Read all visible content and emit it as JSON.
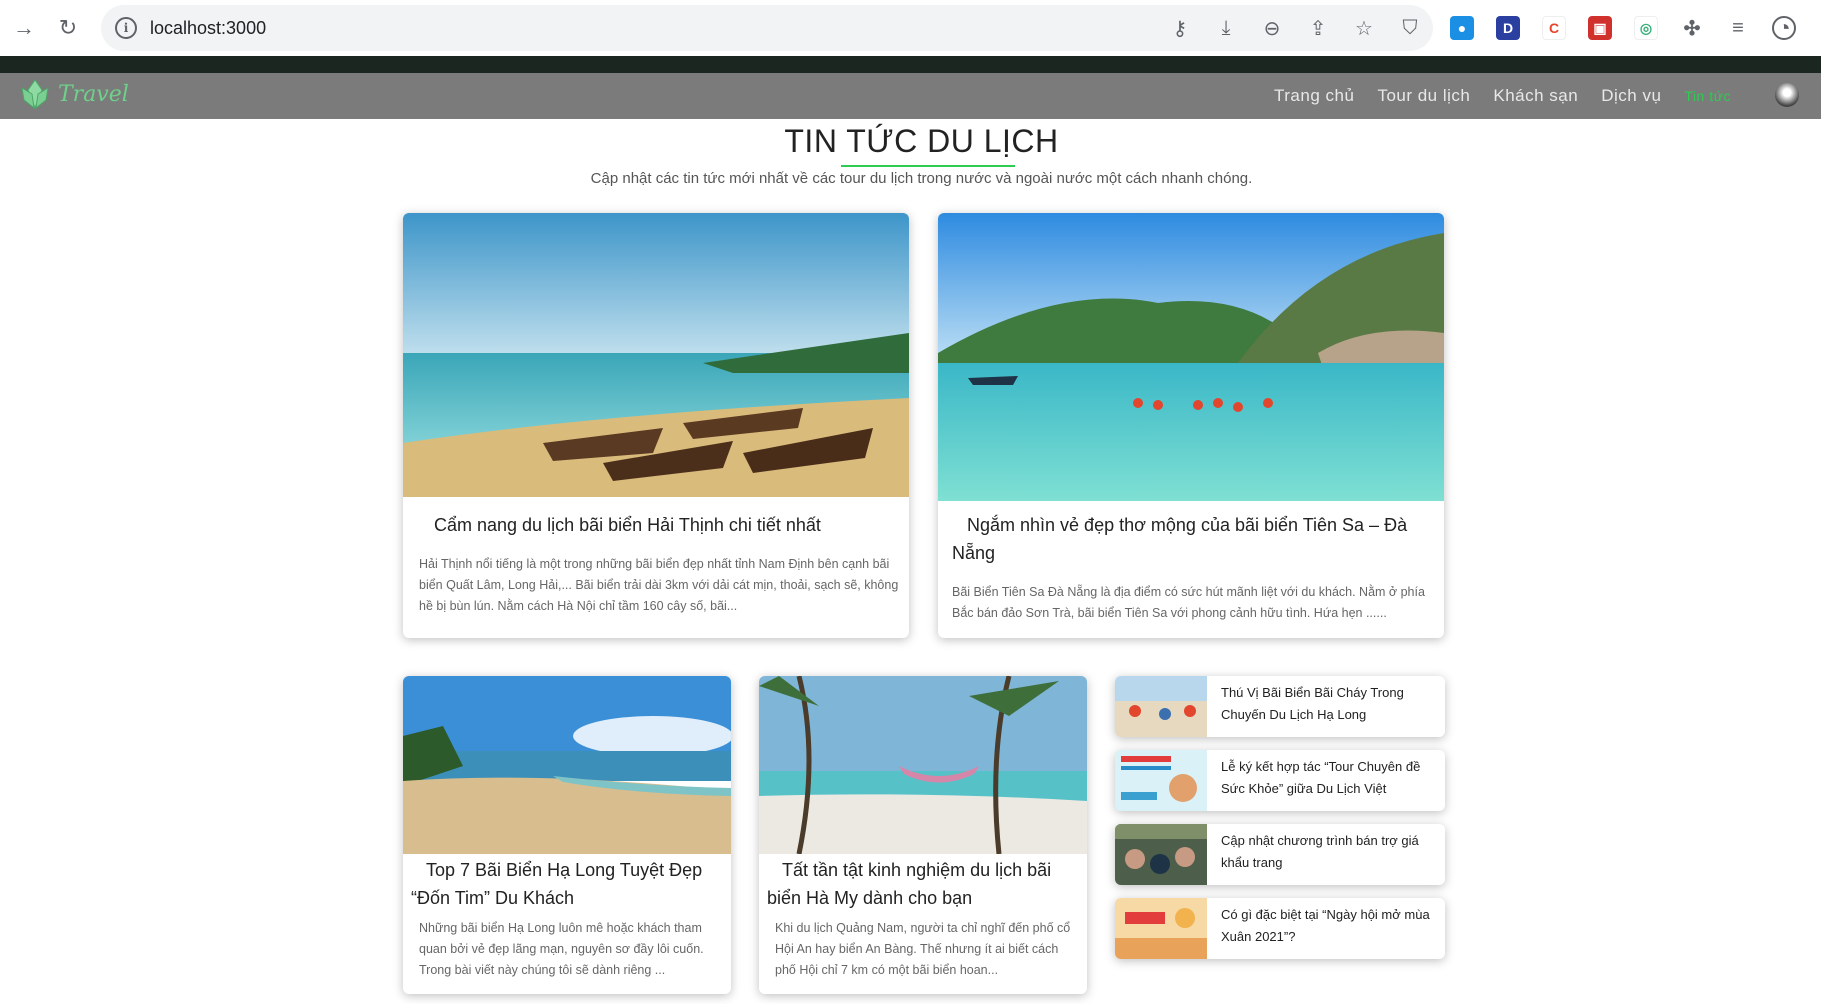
{
  "browser": {
    "url": "localhost:3000"
  },
  "nav": {
    "logo_text": "Travel",
    "items": [
      {
        "label": "Trang chủ"
      },
      {
        "label": "Tour du lịch"
      },
      {
        "label": "Khách sạn"
      },
      {
        "label": "Dịch vụ"
      },
      {
        "label": "Tin tức"
      }
    ]
  },
  "header": {
    "title": "TIN TỨC DU LỊCH",
    "subtitle": "Cập nhật các tin tức mới nhất về các tour du lịch trong nước và ngoài nước một cách nhanh chóng."
  },
  "featured": [
    {
      "title": "Cẩm nang du lịch bãi biển Hải Thịnh chi tiết nhất",
      "excerpt": "Hải Thịnh nổi tiếng là một trong những bãi biển đẹp nhất tỉnh Nam Định bên cạnh bãi biển Quất Lâm, Long Hải,... Bãi biển trải dài 3km với dải cát mịn, thoải, sạch sẽ, không hề bị bùn lún. Nằm cách Hà Nội chỉ tầm 160 cây số, bãi..."
    },
    {
      "title": "Ngắm nhìn vẻ đẹp thơ mộng của bãi biển Tiên Sa – Đà Nẵng",
      "excerpt": "Bãi Biển Tiên Sa Đà Nẵng là địa điểm có sức hút mãnh liệt với du khách. Nằm ở phía Bắc bán đảo Sơn Trà, bãi biển Tiên Sa với phong cảnh hữu tình. Hứa hẹn ......"
    }
  ],
  "articles": [
    {
      "title": "Top 7 Bãi Biển Hạ Long Tuyệt Đẹp “Đốn Tim” Du Khách",
      "excerpt": "Những bãi biển Hạ Long luôn mê hoặc khách tham quan bởi vẻ đẹp lãng mạn, nguyên sơ đầy lôi cuốn. Trong bài viết này chúng tôi sẽ dành riêng ..."
    },
    {
      "title": "Tất tần tật kinh nghiệm du lịch bãi biển Hà My dành cho bạn",
      "excerpt": "Khi du lịch Quảng Nam, người ta chỉ nghĩ đến phố cổ Hội An hay biển An Bàng. Thế nhưng ít ai biết cách phố Hội chỉ 7 km có một bãi biển hoan..."
    }
  ],
  "sidebar": [
    {
      "title": "Thú Vị Bãi Biển Bãi Cháy Trong Chuyến Du Lịch Hạ Long"
    },
    {
      "title": "Lễ ký kết hợp tác “Tour Chuyên đề Sức Khỏe” giữa Du Lịch Việt"
    },
    {
      "title": "Cập nhật chương trình bán trợ giá khẩu trang"
    },
    {
      "title": "Có gì đặc biệt tại “Ngày hội mở mùa Xuân 2021”?"
    }
  ],
  "colors": {
    "accent": "#2ecc52",
    "nav_bg": "#7b7b7b"
  }
}
